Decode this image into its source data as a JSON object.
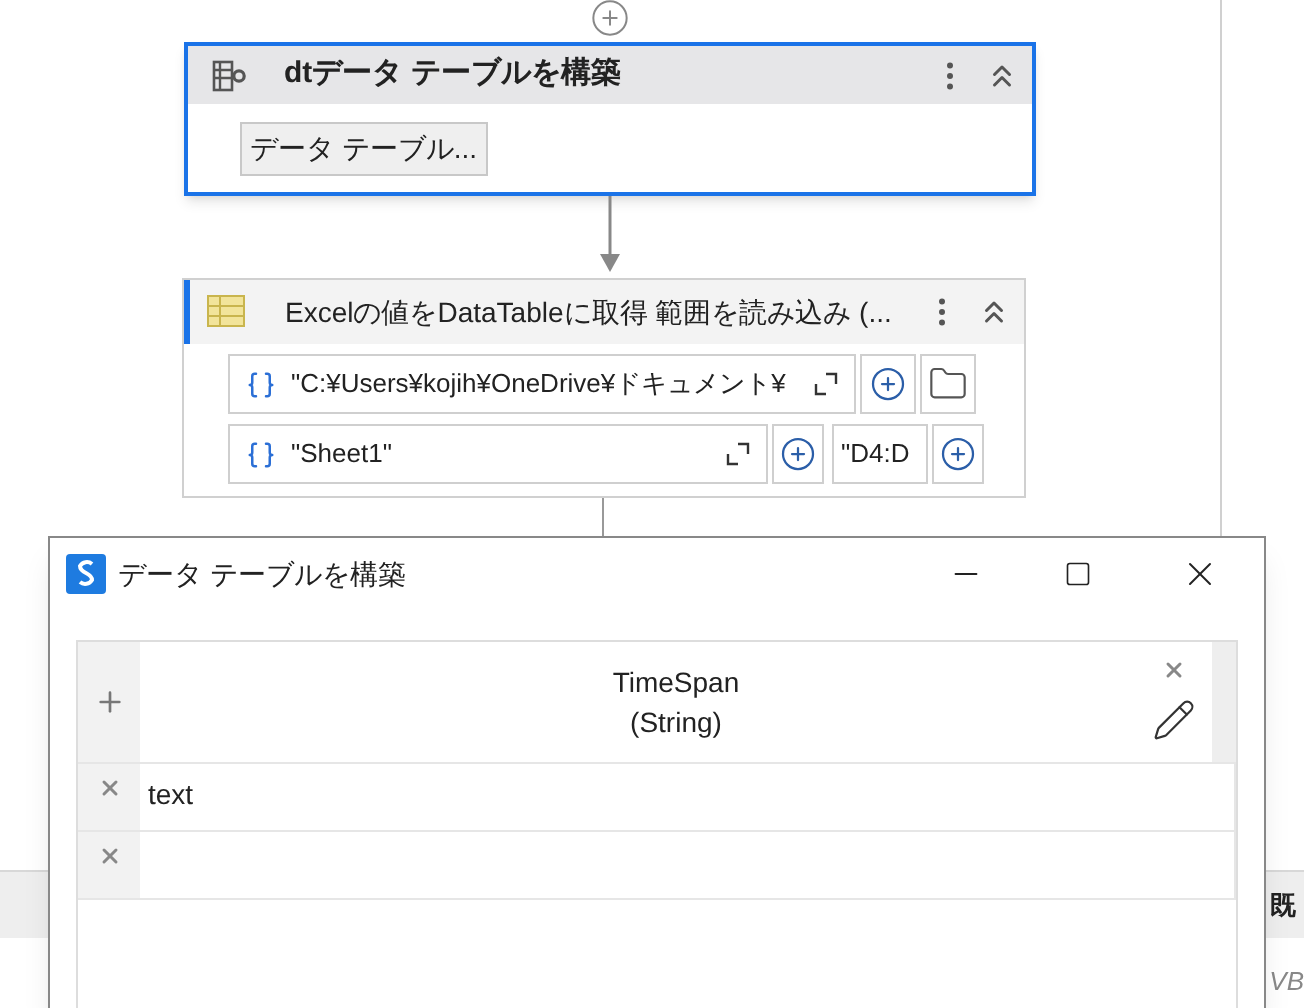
{
  "build_activity": {
    "title": "dtデータ テーブルを構築",
    "button": "データ テーブル...",
    "selected": true
  },
  "read_activity": {
    "title": "Excelの値をDataTableに取得 範囲を読み込み (...",
    "path": "\"C:¥Users¥kojih¥OneDrive¥ドキュメント¥",
    "sheet": "\"Sheet1\"",
    "range": "\"D4:D"
  },
  "property_panel": {
    "header": "既",
    "value": "VB"
  },
  "dialog": {
    "title": "データ テーブルを構築",
    "columns": [
      {
        "name": "TimeSpan",
        "type": "(String)"
      }
    ],
    "rows": [
      {
        "cells": [
          "text"
        ]
      },
      {
        "cells": [
          null
        ]
      }
    ]
  }
}
